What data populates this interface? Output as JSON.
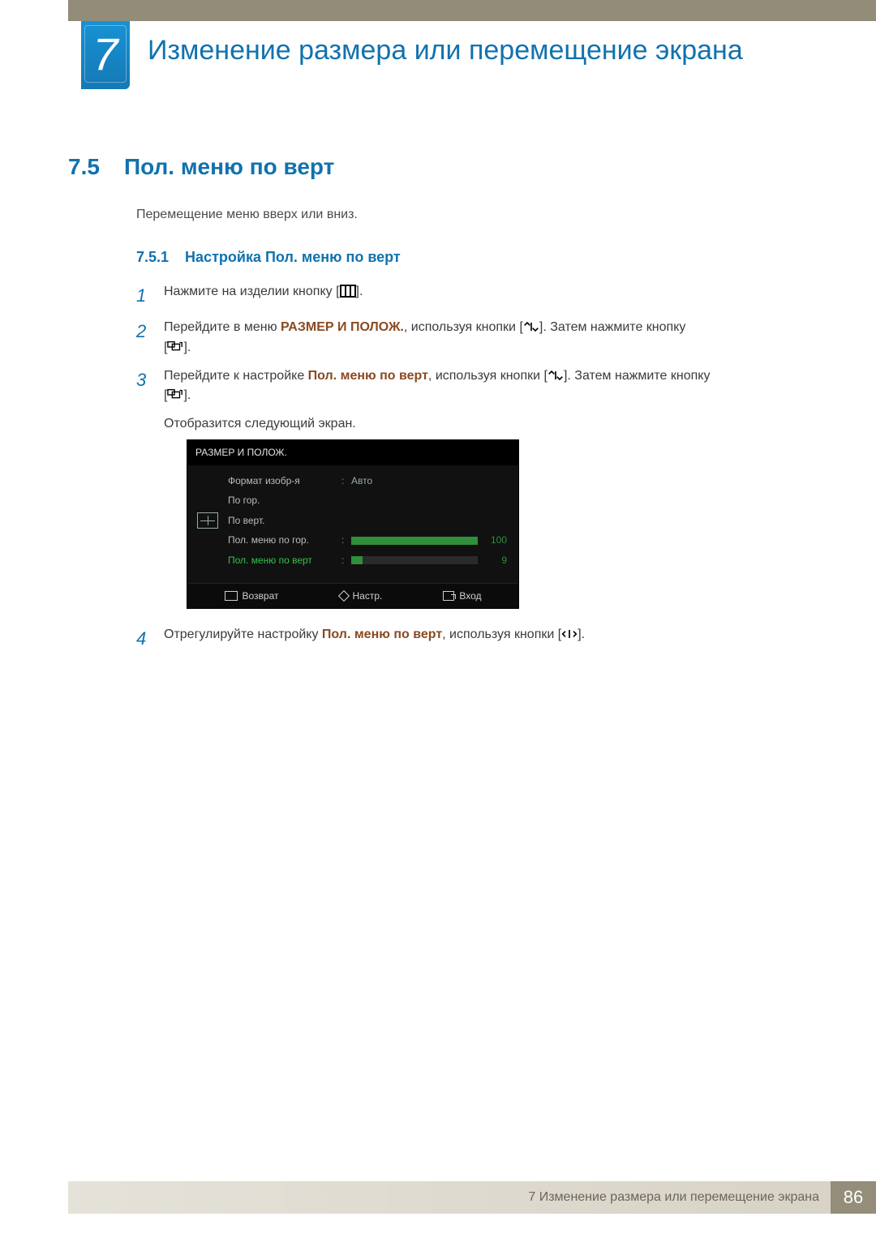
{
  "chapter": {
    "number": "7",
    "title": "Изменение размера или перемещение экрана"
  },
  "section": {
    "number": "7.5",
    "title": "Пол. меню по верт"
  },
  "intro": "Перемещение меню вверх или вниз.",
  "subsection": {
    "number": "7.5.1",
    "title": "Настройка Пол. меню по верт"
  },
  "steps": {
    "s1": {
      "num": "1",
      "pre": "Нажмите на изделии кнопку [",
      "post": "]."
    },
    "s2": {
      "num": "2",
      "pre": "Перейдите в меню ",
      "menu": "РАЗМЕР И ПОЛОЖ.",
      "mid": ", используя кнопки [",
      "tail": "]. Затем нажмите кнопку",
      "line2_pre": "[",
      "line2_post": "]."
    },
    "s3": {
      "num": "3",
      "pre": "Перейдите к настройке ",
      "setting": "Пол. меню по верт",
      "mid": ", используя кнопки [",
      "tail": "]. Затем нажмите кнопку",
      "line2_pre": "[",
      "line2_post": "].",
      "after": "Отобразится следующий экран."
    },
    "s4": {
      "num": "4",
      "pre": "Отрегулируйте настройку ",
      "setting": "Пол. меню по верт",
      "mid": ", используя кнопки [",
      "post": "]."
    }
  },
  "osd": {
    "title": "РАЗМЕР И ПОЛОЖ.",
    "rows": {
      "r1": {
        "label": "Формат изобр-я",
        "value": "Авто"
      },
      "r2": {
        "label": "По гор."
      },
      "r3": {
        "label": "По верт."
      },
      "r4": {
        "label": "Пол. меню по гор.",
        "num": "100"
      },
      "r5": {
        "label": "Пол. меню по верт",
        "num": "9"
      }
    },
    "footer": {
      "back": "Возврат",
      "adjust": "Настр.",
      "enter": "Вход"
    }
  },
  "footer": {
    "chapter_line": "7 Изменение размера или перемещение экрана",
    "page": "86"
  }
}
